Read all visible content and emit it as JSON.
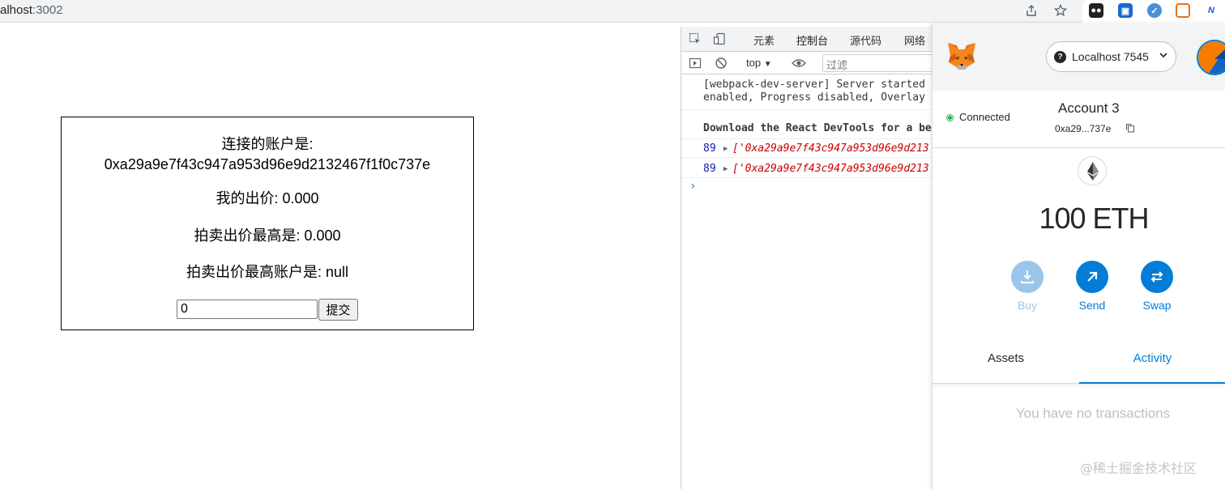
{
  "browser": {
    "url_host": "alhost",
    "url_port": ":3002"
  },
  "app": {
    "connected_label": "连接的账户是:",
    "connected_address": "0xa29a9e7f43c947a953d96e9d2132467f1f0c737e",
    "my_bid": "我的出价: 0.000",
    "highest_bid": "拍卖出价最高是: 0.000",
    "highest_bidder": "拍卖出价最高账户是: null",
    "bid_input_value": "0",
    "submit_label": "提交"
  },
  "devtools": {
    "tabs": [
      "元素",
      "控制台",
      "源代码",
      "网络"
    ],
    "active_tab": "控制台",
    "context": "top",
    "filter_placeholder": "过滤",
    "console_lines": [
      "[webpack-dev-server] Server started",
      "enabled, Progress disabled, Overlay"
    ],
    "devtools_notice": "Download the React DevTools for a be",
    "logs": [
      {
        "line": "89",
        "text": "['0xa29a9e7f43c947a953d96e9d213"
      },
      {
        "line": "89",
        "text": "['0xa29a9e7f43c947a953d96e9d213"
      }
    ],
    "prompt": "›"
  },
  "metamask": {
    "network": "Localhost 7545",
    "connection_status": "Connected",
    "account_name": "Account 3",
    "account_address": "0xa29...737e",
    "balance": "100 ETH",
    "actions": [
      {
        "label": "Buy",
        "icon": "download-icon",
        "enabled": false
      },
      {
        "label": "Send",
        "icon": "arrow-up-right-icon",
        "enabled": true
      },
      {
        "label": "Swap",
        "icon": "swap-icon",
        "enabled": true
      }
    ],
    "tabs": [
      "Assets",
      "Activity"
    ],
    "active_tab": "Activity",
    "empty_message": "You have no transactions",
    "accent_color": "#037dd6"
  },
  "watermark": "@稀土掘金技术社区"
}
